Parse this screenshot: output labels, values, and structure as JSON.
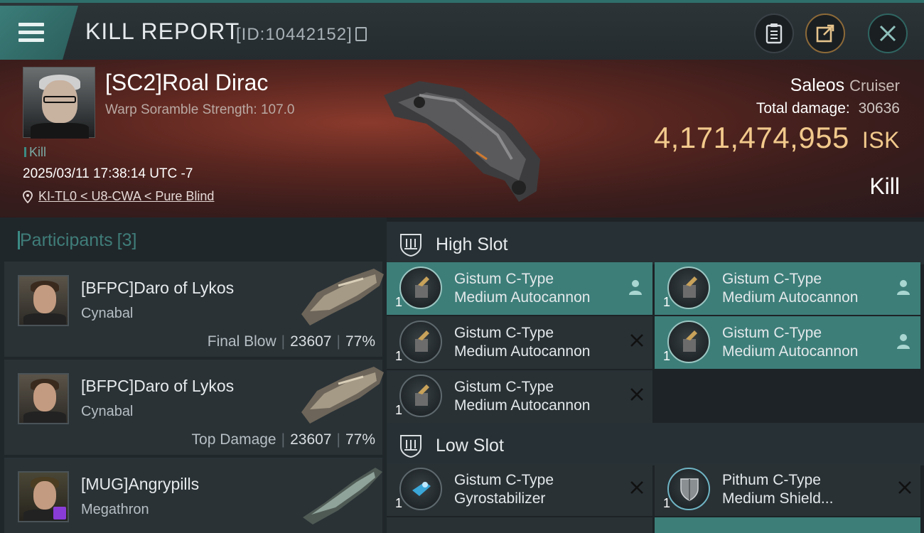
{
  "header": {
    "title": "KILL REPORT",
    "report_id": "[ID:10442152]"
  },
  "victim": {
    "name": "[SC2]Roal Dirac",
    "warp_scramble": "Warp Soramble Strength: 107.0",
    "kill_tag": "Kill",
    "datetime": "2025/03/11 17:38:14 UTC -7",
    "location": "KI-TL0 < U8-CWA < Pure Blind",
    "ship": "Saleos",
    "ship_class": "Cruiser",
    "total_damage_label": "Total damage:",
    "total_damage": "30636",
    "isk_value": "4,171,474,955",
    "isk_unit": "ISK",
    "result": "Kill"
  },
  "participants": {
    "label": "Participants",
    "count": "[3]",
    "items": [
      {
        "name": "[BFPC]Daro of Lykos",
        "ship": "Cynabal",
        "role": "Final Blow",
        "damage": "23607",
        "percent": "77%"
      },
      {
        "name": "[BFPC]Daro of Lykos",
        "ship": "Cynabal",
        "role": "Top Damage",
        "damage": "23607",
        "percent": "77%"
      },
      {
        "name": "[MUG]Angrypills",
        "ship": "Megathron",
        "role": "",
        "damage": "",
        "percent": ""
      }
    ]
  },
  "slots": {
    "high": {
      "label": "High Slot",
      "modules": [
        {
          "line1": "Gistum C-Type",
          "line2": "Medium Autocannon",
          "qty": "1",
          "state": "pilot"
        },
        {
          "line1": "Gistum C-Type",
          "line2": "Medium Autocannon",
          "qty": "1",
          "state": "pilot"
        },
        {
          "line1": "Gistum C-Type",
          "line2": "Medium Autocannon",
          "qty": "1",
          "state": "destroyed"
        },
        {
          "line1": "Gistum C-Type",
          "line2": "Medium Autocannon",
          "qty": "1",
          "state": "pilot"
        },
        {
          "line1": "Gistum C-Type",
          "line2": "Medium Autocannon",
          "qty": "1",
          "state": "destroyed"
        }
      ]
    },
    "low": {
      "label": "Low Slot",
      "modules": [
        {
          "line1": "Gistum C-Type",
          "line2": "Gyrostabilizer",
          "qty": "1",
          "state": "destroyed"
        },
        {
          "line1": "Pithum C-Type",
          "line2": "Medium Shield...",
          "qty": "1",
          "state": "destroyed"
        }
      ]
    }
  },
  "colors": {
    "accent": "#3d7e79",
    "isk": "#f2c98c",
    "purple_badge": "#8a3cd6"
  }
}
